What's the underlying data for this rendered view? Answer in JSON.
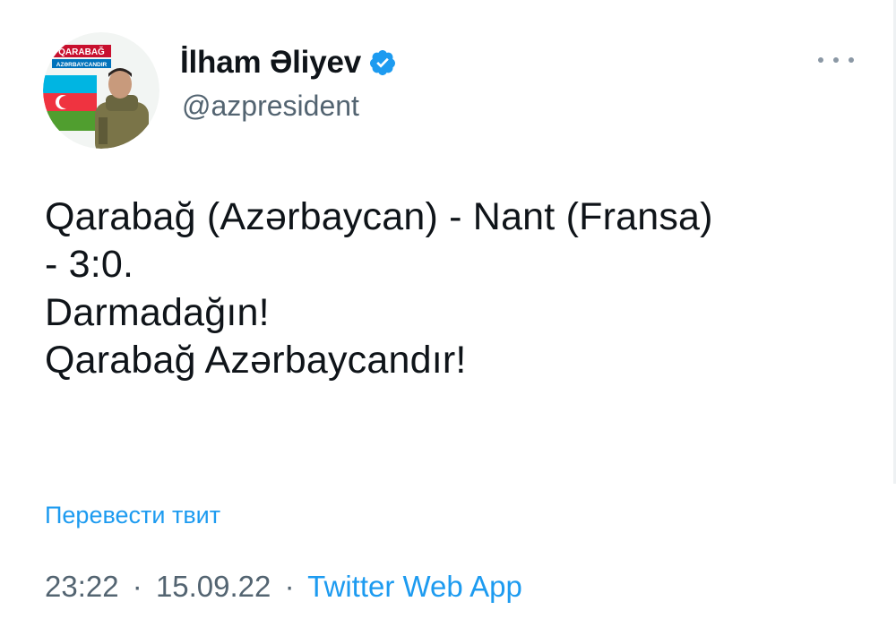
{
  "tweet": {
    "author": {
      "name": "İlham Əliyev",
      "handle": "@azpresident",
      "verified": true,
      "avatar_caption_top": "QARABAĞ",
      "avatar_caption_bottom": "AZƏRBAYCANDIR"
    },
    "text_lines": [
      "Qarabağ (Azərbaycan) - Nant (Fransa)",
      "- 3:0.",
      "Darmadağın!",
      "Qarabağ Azərbaycandır!"
    ],
    "translate_label": "Перевести твит",
    "time": "23:22",
    "separator": "·",
    "date": "15.09.22",
    "source": "Twitter Web App"
  },
  "icons": {
    "more": "more-horizontal-icon",
    "verified": "verified-badge-icon"
  },
  "colors": {
    "text": "#0f1419",
    "secondary": "#536471",
    "link": "#1d9bf0",
    "verified": "#1d9bf0"
  }
}
